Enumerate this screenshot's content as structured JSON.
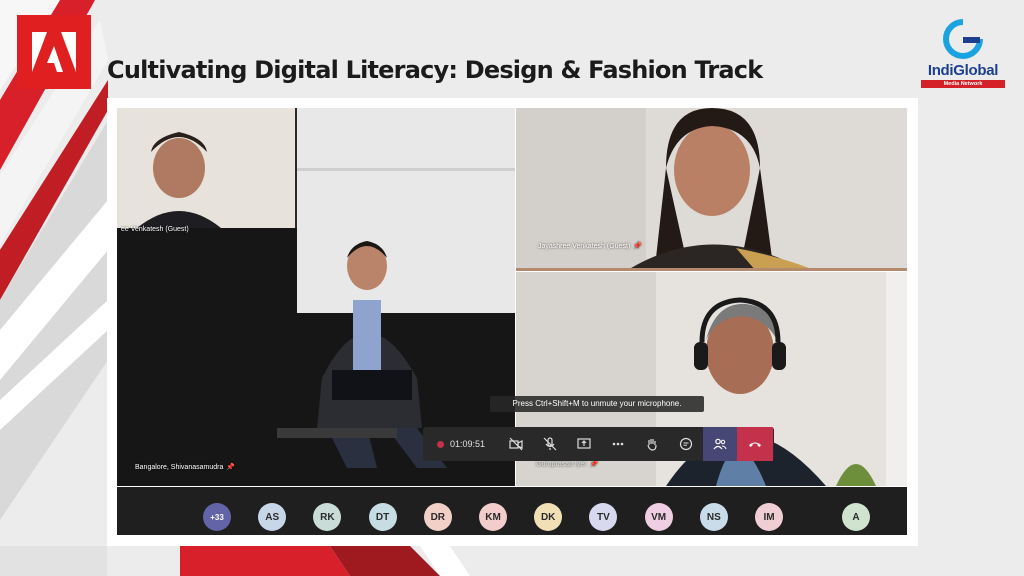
{
  "header": {
    "title": "Cultivating Digital Literacy: Design & Fashion Track"
  },
  "brand": {
    "name": "IndiGlobal",
    "tagline": "Media Network",
    "accent": "#1c3f8f"
  },
  "tiles": {
    "left_label": "Bangalore, Shivanasamudra",
    "left_inset_label": "ee Venkatesh (Guest)",
    "right_top_label": "Jayashree Venkatesh (Guest)",
    "right_bottom_label": "Guruprasad Iyer"
  },
  "toast": "Press Ctrl+Shift+M to unmute your microphone.",
  "controls": {
    "timer": "01:09:51",
    "buttons": [
      "camera-off-icon",
      "mic-off-icon",
      "share-icon",
      "more-icon",
      "raise-hand-icon",
      "chat-icon",
      "people-icon",
      "hangup-icon"
    ],
    "hangup_color": "#c4314b",
    "record_color": "#c4314b"
  },
  "roster": {
    "more": "+33",
    "participants": [
      {
        "initials": "AS",
        "color": "#c7d7e8"
      },
      {
        "initials": "RK",
        "color": "#c9dcd8"
      },
      {
        "initials": "DT",
        "color": "#c6dde3"
      },
      {
        "initials": "DR",
        "color": "#f2cfc7"
      },
      {
        "initials": "KM",
        "color": "#f3cccc"
      },
      {
        "initials": "DK",
        "color": "#f1e0b5"
      },
      {
        "initials": "TV",
        "color": "#d8d8ef"
      },
      {
        "initials": "VM",
        "color": "#efcde2"
      },
      {
        "initials": "NS",
        "color": "#c9dcea"
      },
      {
        "initials": "IM",
        "color": "#f0cfd4"
      }
    ],
    "self": {
      "initials": "A",
      "color": "#cfe3cf"
    }
  }
}
